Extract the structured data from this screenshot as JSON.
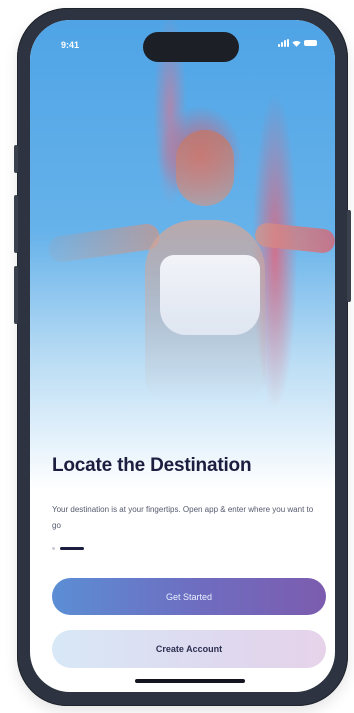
{
  "status_bar": {
    "time": "9:41",
    "icons": [
      "signal-icon",
      "wifi-icon",
      "battery-icon"
    ]
  },
  "hero": {
    "image": "athlete-photo"
  },
  "onboarding": {
    "title": "Locate the Destination",
    "subtitle": "Your destination is at your fingertips. Open app & enter where you want to go",
    "page_indicator": {
      "current": 2,
      "total": 2
    }
  },
  "actions": {
    "get_started_label": "Get Started",
    "create_account_label": "Create Account"
  },
  "colors": {
    "frame": "#2d3340",
    "title": "#1c1d3f",
    "primary_gradient_start": "#5b8ed4",
    "primary_gradient_end": "#7c5cae",
    "secondary_gradient_start": "#d8e8f6",
    "secondary_gradient_end": "#e6d3ea"
  }
}
